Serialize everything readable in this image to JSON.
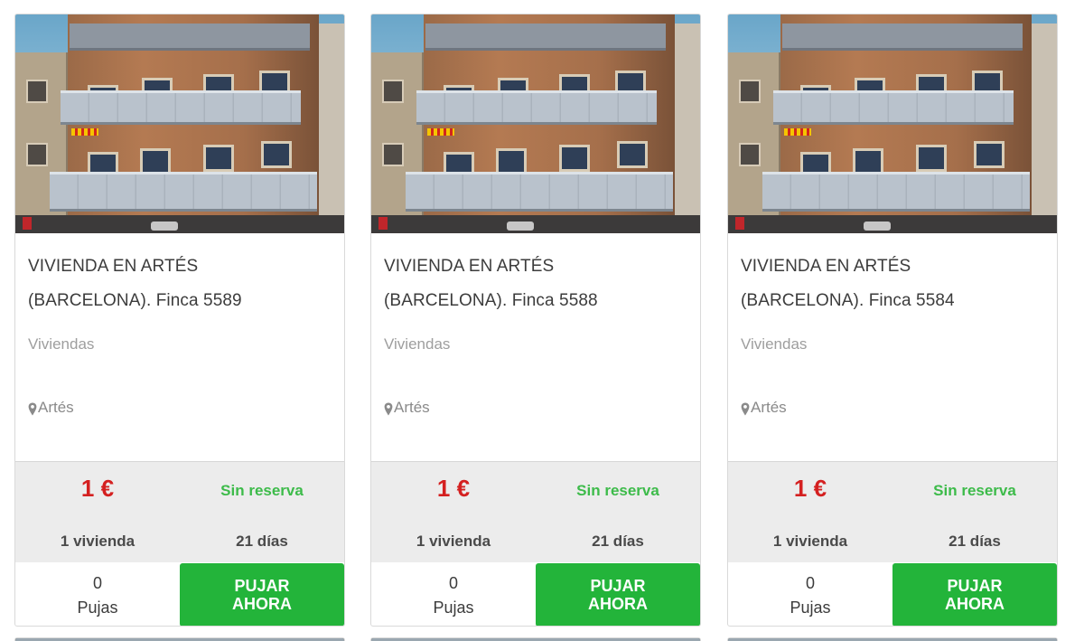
{
  "listings": [
    {
      "title_line1": "VIVIENDA EN ARTÉS",
      "title_line2": "(BARCELONA). Finca 5589",
      "category": "Viviendas",
      "location": "Artés",
      "price": "1 €",
      "reserve": "Sin reserva",
      "units": "1 vivienda",
      "days": "21 días",
      "bids_count": "0",
      "bids_label": "Pujas",
      "bid_button": "PUJAR\nAHORA"
    },
    {
      "title_line1": "VIVIENDA EN ARTÉS",
      "title_line2": "(BARCELONA). Finca 5588",
      "category": "Viviendas",
      "location": "Artés",
      "price": "1 €",
      "reserve": "Sin reserva",
      "units": "1 vivienda",
      "days": "21 días",
      "bids_count": "0",
      "bids_label": "Pujas",
      "bid_button": "PUJAR\nAHORA"
    },
    {
      "title_line1": "VIVIENDA EN ARTÉS",
      "title_line2": "(BARCELONA). Finca 5584",
      "category": "Viviendas",
      "location": "Artés",
      "price": "1 €",
      "reserve": "Sin reserva",
      "units": "1 vivienda",
      "days": "21 días",
      "bids_count": "0",
      "bids_label": "Pujas",
      "bid_button": "PUJAR\nAHORA"
    }
  ],
  "icons": {
    "location": "map-pin-icon"
  },
  "colors": {
    "price": "#d42020",
    "reserve": "#3dbb4a",
    "bid_button": "#23b43a",
    "stats_bg": "#ececec"
  }
}
